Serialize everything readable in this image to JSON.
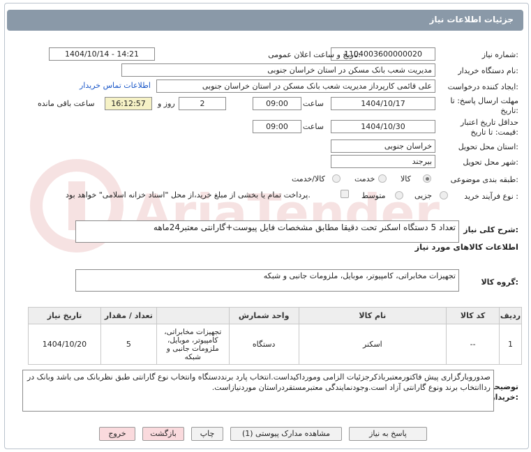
{
  "header": {
    "title": "جزئیات اطلاعات نیاز"
  },
  "watermark": {
    "text": "AriaTender.net",
    "color": "#c02a2a"
  },
  "fields": {
    "need_number_label": "شماره نیاز:",
    "need_number": "1104003600000020",
    "announce_label": "تاریخ و ساعت اعلان عمومی:",
    "announce_value": "1404/10/14 - 14:21",
    "buyer_label": "نام دستگاه خریدار:",
    "buyer": "مدیریت شعب بانک مسکن در استان خراسان جنوبی",
    "creator_label": "ایجاد کننده درخواست:",
    "creator": "علی قائمی کارپرداز مدیریت شعب بانک مسکن در استان خراسان جنوبی",
    "contact_link": "اطلاعات تماس خریدار",
    "deadline_label_1": "مهلت ارسال پاسخ: تا",
    "deadline_label_2": "تاریخ:",
    "deadline_date": "1404/10/17",
    "time_label": "ساعت",
    "deadline_time": "09:00",
    "days_value": "2",
    "days_label": "روز و",
    "remaining_time": "16:12:57",
    "remaining_label": "ساعت باقی مانده",
    "validity_label_1": "حداقل تاریخ اعتبار",
    "validity_label_2": "قیمت: تا تاریخ:",
    "validity_date": "1404/10/30",
    "validity_time": "09:00",
    "province_label": "استان محل تحویل:",
    "province": "خراسان جنوبی",
    "city_label": "شهر محل تحویل:",
    "city": "بیرجند",
    "category_label": "طبقه بندی موضوعی:",
    "category_options": [
      "کالا",
      "خدمت",
      "کالا/خدمت"
    ],
    "process_label": "نوع فرآیند خرید :",
    "process_options": [
      "جزیی",
      "متوسط"
    ],
    "payment_note": "پرداخت تمام یا بخشی از مبلغ خرید،از محل \"اسناد خزانه اسلامی\" خواهد بود."
  },
  "summary": {
    "label": "شرح کلی نیاز:",
    "text": "تعداد 5 دستگاه اسکنر تحت دقیقا مطابق مشخصات فایل پیوست+گارانتی معتبر24ماهه"
  },
  "goods": {
    "section_title": "اطلاعات کالاهای مورد نیاز",
    "group_label": "گروه کالا:",
    "group_value": "تجهیزات مخابراتی، کامپیوتر، موبایل، ملزومات جانبی و شبکه"
  },
  "table": {
    "headers": [
      "ردیف",
      "کد کالا",
      "نام کالا",
      "واحد شمارش",
      "تعداد / مقدار",
      "تاریخ نیاز"
    ],
    "rows": [
      {
        "row": "1",
        "code": "--",
        "name": "اسکنر",
        "unit": "دستگاه",
        "qty": "5",
        "date": "1404/10/20",
        "group": "تجهیزات مخابراتی، کامپیوتر، موبایل، ملزومات جانبی و شبکه"
      }
    ]
  },
  "buyer_notes": {
    "label_1": "توضیحات",
    "label_2": "خریدار:",
    "text": "صدوروبارگزاری پیش فاکتورمعتبرباذکرجزئیات الزامی ومورداکیداست.انتخاب پارد برنددستگاه وانتخاب نوع گارانتی طبق نظربانک می باشد وبانک در رداانتخاب برند ونوع گارانتی آزاد است.وجودنمایندگی معتبرمستقردراستان موردنیازاست."
  },
  "buttons": {
    "reply": "پاسخ به نیاز",
    "attachments": "مشاهده مدارک پیوستی (1)",
    "print": "چاپ",
    "back": "بازگشت",
    "exit": "خروج"
  }
}
